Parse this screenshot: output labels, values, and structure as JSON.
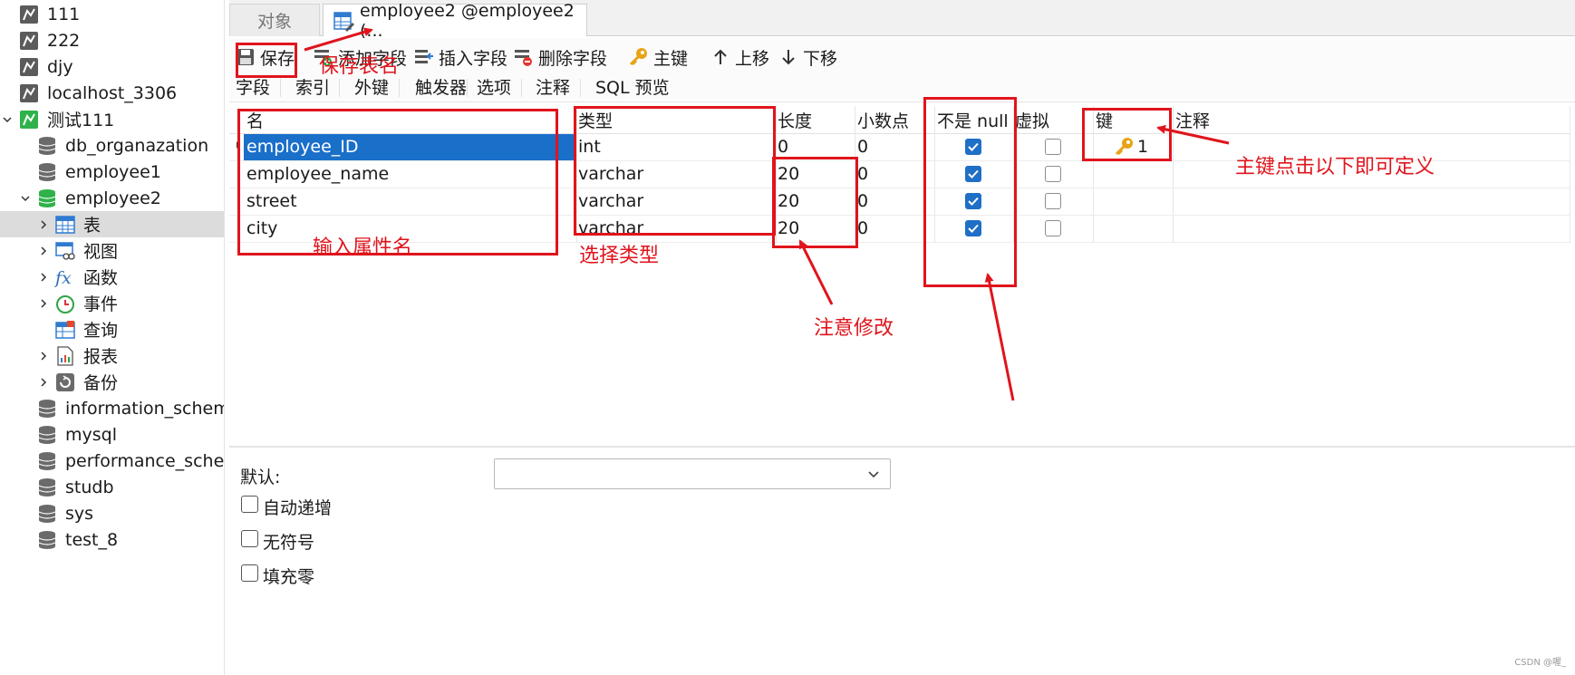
{
  "nav": {
    "items": [
      {
        "label": "111",
        "icon": "connection-icon"
      },
      {
        "label": "222",
        "icon": "connection-icon"
      },
      {
        "label": "djy",
        "icon": "connection-icon"
      },
      {
        "label": "localhost_3306",
        "icon": "connection-icon"
      },
      {
        "label": "测试111",
        "icon": "connection-open-icon"
      },
      {
        "label": "db_organazation",
        "icon": "database-icon"
      },
      {
        "label": "employee1",
        "icon": "database-icon"
      },
      {
        "label": "employee2",
        "icon": "database-open-icon"
      },
      {
        "label": "表",
        "icon": "table-icon"
      },
      {
        "label": "视图",
        "icon": "view-icon"
      },
      {
        "label": "函数",
        "icon": "function-icon"
      },
      {
        "label": "事件",
        "icon": "event-icon"
      },
      {
        "label": "查询",
        "icon": "query-icon"
      },
      {
        "label": "报表",
        "icon": "report-icon"
      },
      {
        "label": "备份",
        "icon": "backup-icon"
      },
      {
        "label": "information_schema",
        "icon": "database-icon"
      },
      {
        "label": "mysql",
        "icon": "database-icon"
      },
      {
        "label": "performance_schema",
        "icon": "database-icon"
      },
      {
        "label": "studb",
        "icon": "database-icon"
      },
      {
        "label": "sys",
        "icon": "database-icon"
      },
      {
        "label": "test_8",
        "icon": "database-icon"
      }
    ]
  },
  "tabs": {
    "objects": "对象",
    "active": "employee2 @employee2 (..."
  },
  "toolbar": {
    "save": "保存",
    "add_field": "添加字段",
    "insert_field": "插入字段",
    "delete_field": "删除字段",
    "primary_key": "主键",
    "move_up": "上移",
    "move_down": "下移"
  },
  "subtabs": [
    "字段",
    "索引",
    "外键",
    "触发器",
    "选项",
    "注释",
    "SQL 预览"
  ],
  "grid": {
    "headers": {
      "name": "名",
      "type": "类型",
      "length": "长度",
      "decimals": "小数点",
      "not_null": "不是 null",
      "virtual": "虚拟",
      "key": "键",
      "comment": "注释"
    },
    "rows": [
      {
        "name": "employee_ID",
        "type": "int",
        "length": "0",
        "decimals": "0",
        "not_null": true,
        "virtual": false,
        "key": "1"
      },
      {
        "name": "employee_name",
        "type": "varchar",
        "length": "20",
        "decimals": "0",
        "not_null": true,
        "virtual": false,
        "key": ""
      },
      {
        "name": "street",
        "type": "varchar",
        "length": "20",
        "decimals": "0",
        "not_null": true,
        "virtual": false,
        "key": ""
      },
      {
        "name": "city",
        "type": "varchar",
        "length": "20",
        "decimals": "0",
        "not_null": true,
        "virtual": false,
        "key": ""
      }
    ]
  },
  "bottom": {
    "default_label": "默认:",
    "auto_increment": "自动递增",
    "unsigned": "无符号",
    "zerofill": "填充零"
  },
  "annotations": {
    "save_table_name": "保存表名",
    "input_attr_name": "输入属性名",
    "choose_type": "选择类型",
    "note_modify": "注意修改",
    "primary_key_hint": "主键点击以下即可定义"
  },
  "watermark": "CSDN @喔_",
  "colors": {
    "accent": "#1a6fc9",
    "annotation": "#e0141c",
    "selected_nav": "#dcdcdc"
  }
}
